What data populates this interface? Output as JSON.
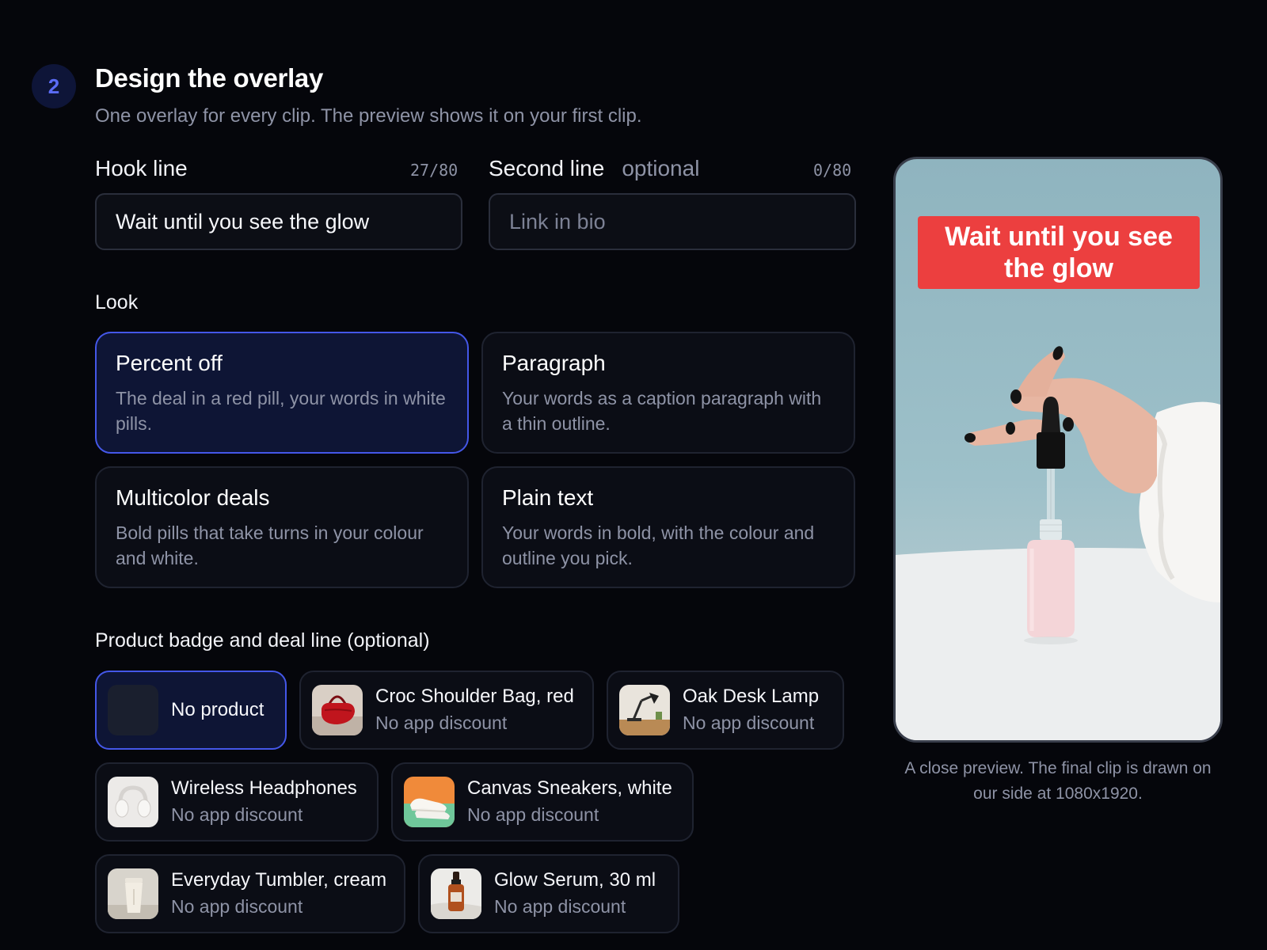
{
  "step": {
    "number": "2",
    "title": "Design the overlay",
    "subtitle": "One overlay for every clip. The preview shows it on your first clip."
  },
  "hook_line": {
    "label": "Hook line",
    "count": "27/80",
    "value": "Wait until you see the glow"
  },
  "second_line": {
    "label": "Second line",
    "optional": "optional",
    "count": "0/80",
    "placeholder": "Link in bio",
    "value": ""
  },
  "look": {
    "label": "Look",
    "options": [
      {
        "title": "Percent off",
        "desc": "The deal in a red pill, your words in white pills.",
        "selected": true
      },
      {
        "title": "Paragraph",
        "desc": "Your words as a caption paragraph with a thin outline.",
        "selected": false
      },
      {
        "title": "Multicolor deals",
        "desc": "Bold pills that take turns in your colour and white.",
        "selected": false
      },
      {
        "title": "Plain text",
        "desc": "Your words in bold, with the colour and outline you pick.",
        "selected": false
      }
    ]
  },
  "products": {
    "label": "Product badge and deal line (optional)",
    "items": [
      {
        "name": "No product",
        "sub": "",
        "selected": true,
        "icon": "empty-thumb"
      },
      {
        "name": "Croc Shoulder Bag, red",
        "sub": "No app discount",
        "selected": false,
        "icon": "red-bag-thumb"
      },
      {
        "name": "Oak Desk Lamp",
        "sub": "No app discount",
        "selected": false,
        "icon": "desk-lamp-thumb"
      },
      {
        "name": "Wireless Headphones",
        "sub": "No app discount",
        "selected": false,
        "icon": "headphones-thumb"
      },
      {
        "name": "Canvas Sneakers, white",
        "sub": "No app discount",
        "selected": false,
        "icon": "sneakers-thumb"
      },
      {
        "name": "Everyday Tumbler, cream",
        "sub": "No app discount",
        "selected": false,
        "icon": "tumbler-thumb"
      },
      {
        "name": "Glow Serum, 30 ml",
        "sub": "No app discount",
        "selected": false,
        "icon": "serum-thumb"
      }
    ]
  },
  "preview": {
    "overlay_text": "Wait until you see the glow",
    "caption": "A close preview. The final clip is drawn on our side at 1080x1920."
  },
  "colors": {
    "accent": "#4457e8",
    "overlay_red": "#ec3f3f",
    "background": "#05060b"
  }
}
